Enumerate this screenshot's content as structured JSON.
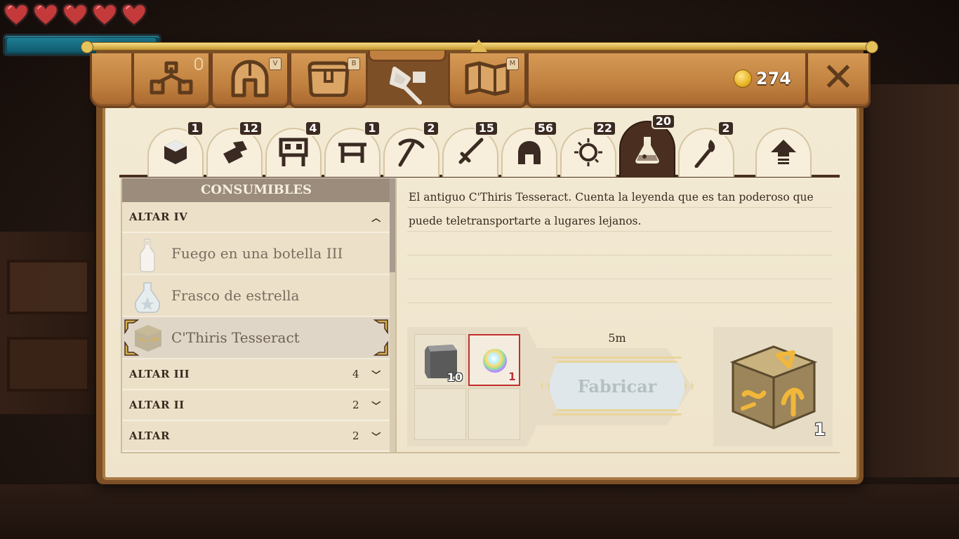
{
  "hud": {
    "hearts": 5,
    "mana_fraction": 0.99
  },
  "top_tabs": [
    {
      "name": "skills",
      "icon": "skill-tree-icon",
      "key": ""
    },
    {
      "name": "equipment",
      "icon": "helmet-icon",
      "key": "V"
    },
    {
      "name": "inventory",
      "icon": "bag-icon",
      "key": "B"
    },
    {
      "name": "crafting",
      "icon": "crafting-icon",
      "key": ""
    },
    {
      "name": "map",
      "icon": "map-icon",
      "key": "M"
    }
  ],
  "currency": {
    "amount": "274",
    "icon": "gold-coin-icon"
  },
  "close_label": "✕",
  "categories": [
    {
      "icon": "block-icon",
      "count": "1"
    },
    {
      "icon": "materials-icon",
      "count": "12"
    },
    {
      "icon": "station-icon",
      "count": "4"
    },
    {
      "icon": "table-icon",
      "count": "1"
    },
    {
      "icon": "pickaxe-icon",
      "count": "2"
    },
    {
      "icon": "sword-icon",
      "count": "15"
    },
    {
      "icon": "helmet-icon",
      "count": "56"
    },
    {
      "icon": "accessory-icon",
      "count": "22"
    },
    {
      "icon": "potion-icon",
      "count": "20",
      "active": true
    },
    {
      "icon": "torch-icon",
      "count": "2"
    },
    {
      "icon": "upgrade-arrow-icon",
      "count": ""
    }
  ],
  "list": {
    "header": "CONSUMIBLES",
    "groups": [
      {
        "label": "ALTAR IV",
        "count": "",
        "expanded": true,
        "items": [
          {
            "label": "Fuego en una botella III",
            "icon": "fire-bottle-icon"
          },
          {
            "label": "Frasco de estrella",
            "icon": "star-flask-icon"
          },
          {
            "label": "C'Thiris Tesseract",
            "icon": "tesseract-icon",
            "selected": true
          }
        ]
      },
      {
        "label": "ALTAR III",
        "count": "4",
        "expanded": false
      },
      {
        "label": "ALTAR II",
        "count": "2",
        "expanded": false
      },
      {
        "label": "ALTAR",
        "count": "2",
        "expanded": false
      }
    ]
  },
  "detail": {
    "description": "El antiguo C'Thiris Tesseract. Cuenta la leyenda que es tan poderoso que puede teletransportarte a lugares lejanos.",
    "ingredients": [
      {
        "icon": "stone-block-icon",
        "qty": "10",
        "insufficient": false
      },
      {
        "icon": "rainbow-orb-icon",
        "qty": "1",
        "insufficient": true
      }
    ],
    "craft_time": "5m",
    "craft_button": "Fabricar",
    "result": {
      "icon": "tesseract-icon",
      "qty": "1"
    }
  },
  "colors": {
    "parchment": "#f3ead4",
    "wood": "#c0803f",
    "active_tab": "#4a2f20",
    "insufficient": "#c0312d"
  }
}
